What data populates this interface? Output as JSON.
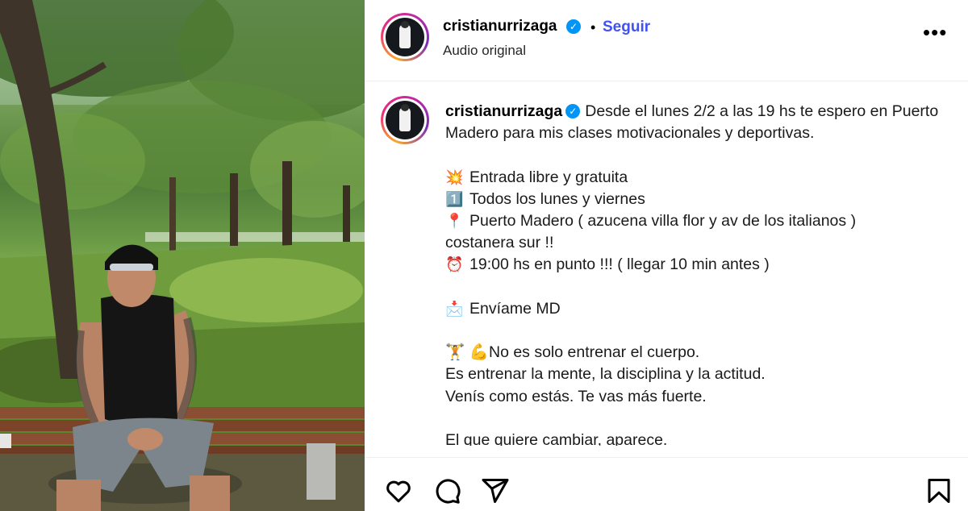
{
  "post": {
    "username": "cristianurrizaga",
    "verified_mark": "✓",
    "separator": "•",
    "follow_label": "Seguir",
    "audio_label": "Audio original",
    "more_label": "•••"
  },
  "caption": {
    "username": "cristianurrizaga",
    "intro": "Desde el lunes 2/2 a las 19 hs te espero en Puerto Madero para mis clases motivacionales y deportivas.",
    "line1_emoji": "💥",
    "line1": "Entrada libre y gratuita",
    "line2_emoji": "1️⃣",
    "line2": "Todos los lunes y viernes",
    "line3_emoji": "📍",
    "line3": "Puerto Madero ( azucena villa flor y av de los italianos )",
    "line4": "costanera sur !!",
    "line5_emoji": "⏰",
    "line5": "19:00 hs en punto !!! ( llegar 10 min antes )",
    "line6_emoji": "📩",
    "line6": "Envíame MD",
    "line7_emoji": "🏋️ 💪",
    "line7": "No es solo entrenar el cuerpo.",
    "line8": "Es entrenar la mente, la disciplina y la actitud.",
    "line9": "Venís como estás. Te vas más fuerte.",
    "line10": "El que quiere cambiar, aparece."
  },
  "actions": {
    "like_icon": "heart-icon",
    "comment_icon": "comment-icon",
    "share_icon": "share-icon",
    "save_icon": "bookmark-icon"
  },
  "colors": {
    "follow": "#4150f7",
    "verified": "#0095f6"
  }
}
